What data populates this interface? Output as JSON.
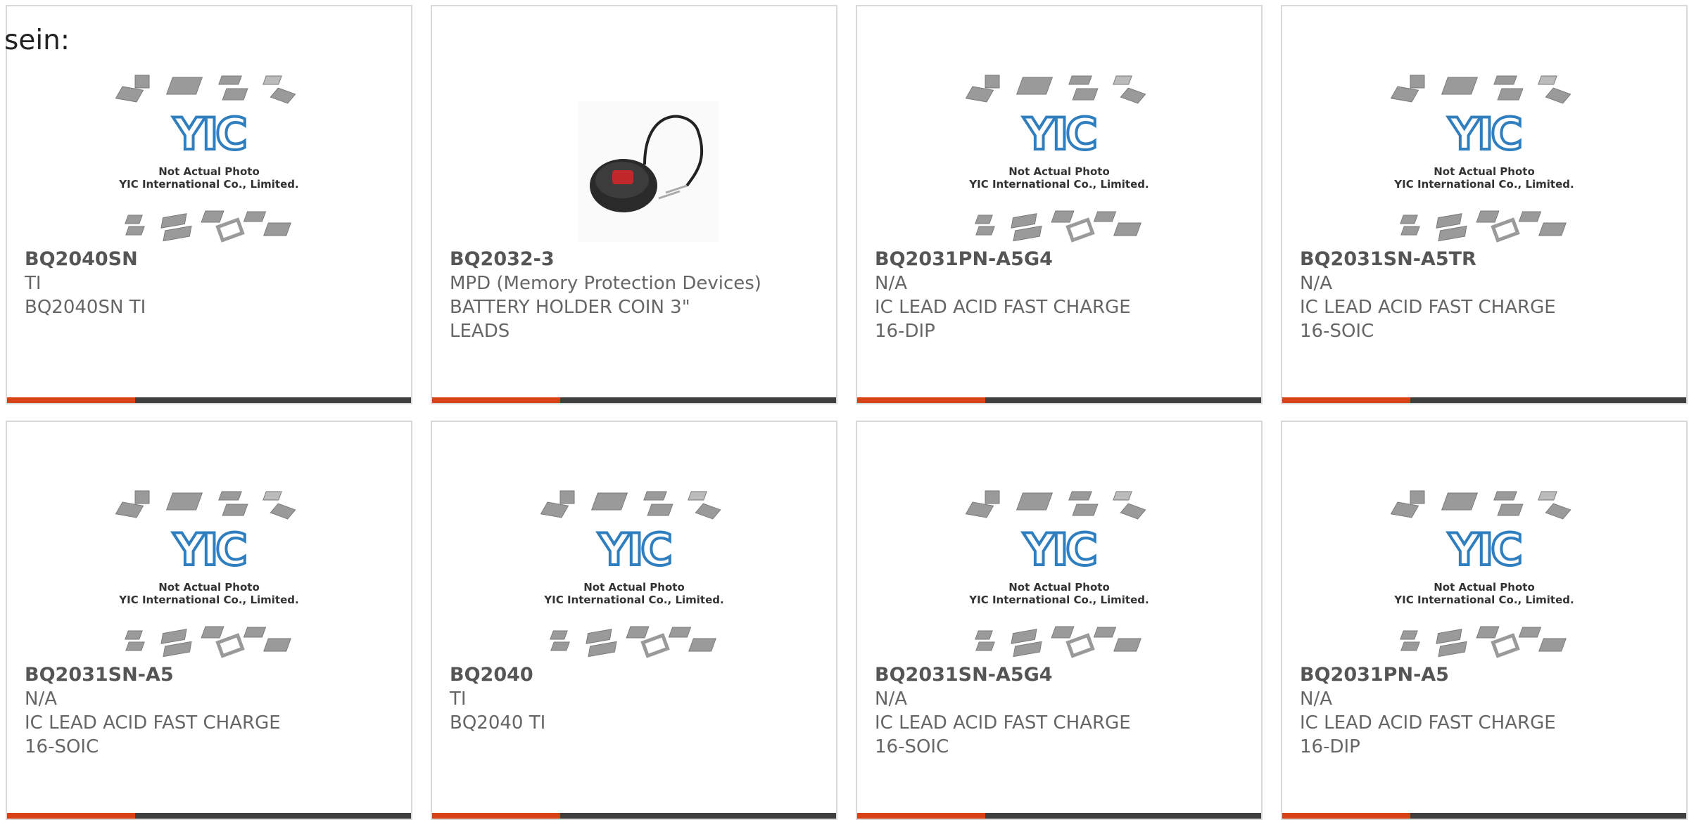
{
  "heading": "sein:",
  "placeholder": {
    "caption_line1": "Not Actual Photo",
    "caption_line2": "YIC International Co., Limited.",
    "logo_text": "YIC"
  },
  "products": [
    {
      "part": "BQ2040SN",
      "maker": "TI",
      "desc": "BQ2040SN TI",
      "image": "placeholder"
    },
    {
      "part": "BQ2032-3",
      "maker": "MPD (Memory Protection Devices)",
      "desc": "BATTERY HOLDER COIN 3\" LEADS",
      "image": "battery-holder-photo"
    },
    {
      "part": "BQ2031PN-A5G4",
      "maker": "N/A",
      "desc": "IC LEAD ACID FAST CHARGE 16-DIP",
      "image": "placeholder"
    },
    {
      "part": "BQ2031SN-A5TR",
      "maker": "N/A",
      "desc": "IC LEAD ACID FAST CHARGE 16-SOIC",
      "image": "placeholder"
    },
    {
      "part": "BQ2031SN-A5",
      "maker": "N/A",
      "desc": "IC LEAD ACID FAST CHARGE 16-SOIC",
      "image": "placeholder"
    },
    {
      "part": "BQ2040",
      "maker": "TI",
      "desc": "BQ2040 TI",
      "image": "placeholder"
    },
    {
      "part": "BQ2031SN-A5G4",
      "maker": "N/A",
      "desc": "IC LEAD ACID FAST CHARGE 16-SOIC",
      "image": "placeholder"
    },
    {
      "part": "BQ2031PN-A5",
      "maker": "N/A",
      "desc": "IC LEAD ACID FAST CHARGE 16-DIP",
      "image": "placeholder"
    }
  ],
  "colors": {
    "accent": "#d94214",
    "bar": "#3f3f3f",
    "logo_blue": "#2f7fc0",
    "chip_grey": "#9a9a9a"
  }
}
